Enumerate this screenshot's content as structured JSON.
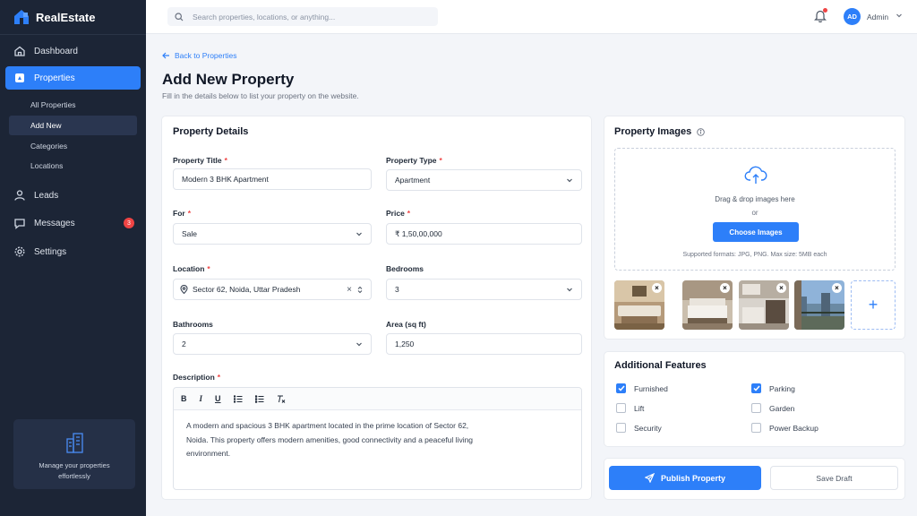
{
  "brand": {
    "name": "RealEstate"
  },
  "colors": {
    "accent": "#2d7ff9",
    "sidebar": "#1c2536",
    "badge": "#ef4444"
  },
  "sidebar": {
    "nav": [
      {
        "label": "Dashboard",
        "icon": "home-icon"
      },
      {
        "label": "Properties",
        "icon": "building-icon"
      },
      {
        "label": "Leads",
        "icon": "user-icon"
      },
      {
        "label": "Messages",
        "icon": "chat-icon",
        "badge": "3"
      },
      {
        "label": "Settings",
        "icon": "gear-icon"
      }
    ],
    "sub": [
      "All Properties",
      "Add New",
      "Categories",
      "Locations"
    ],
    "promo": "Manage your properties effortlessly"
  },
  "topbar": {
    "search_placeholder": "Search properties, locations, or anything...",
    "avatar": "AD",
    "user": "Admin"
  },
  "page": {
    "back": "Back to Properties",
    "title": "Add New Property",
    "subtitle": "Fill in the details below to list your property on the website."
  },
  "details": {
    "title": "Property Details",
    "title_label": "Property Title",
    "title_value": "Modern 3 BHK Apartment",
    "type_label": "Property Type",
    "type_value": "Apartment",
    "for_label": "For",
    "for_value": "Sale",
    "price_label": "Price",
    "price_value": "₹ 1,50,00,000",
    "location_label": "Location",
    "location_value": "Sector 62, Noida, Uttar Pradesh",
    "bedrooms_label": "Bedrooms",
    "bedrooms_value": "3",
    "bathrooms_label": "Bathrooms",
    "bathrooms_value": "2",
    "area_label": "Area (sq ft)",
    "area_value": "1,250",
    "description_label": "Description",
    "description_value": "A modern and spacious 3 BHK apartment located in the prime location of Sector 62, Noida. This property offers modern amenities, good connectivity and a peaceful living environment.",
    "toolbar": {
      "bold": "B",
      "italic": "I",
      "underline": "U"
    }
  },
  "images": {
    "title": "Property Images",
    "drag_text": "Drag & drop images here",
    "or_text": "or",
    "choose_label": "Choose Images",
    "formats": "Supported formats: JPG, PNG. Max size: 5MB each",
    "add_label": "+"
  },
  "features": {
    "title": "Additional Features",
    "items": [
      {
        "label": "Furnished",
        "checked": true
      },
      {
        "label": "Parking",
        "checked": true
      },
      {
        "label": "Lift",
        "checked": false
      },
      {
        "label": "Garden",
        "checked": false
      },
      {
        "label": "Security",
        "checked": false
      },
      {
        "label": "Power Backup",
        "checked": false
      }
    ]
  },
  "actions": {
    "publish": "Publish Property",
    "draft": "Save Draft"
  }
}
